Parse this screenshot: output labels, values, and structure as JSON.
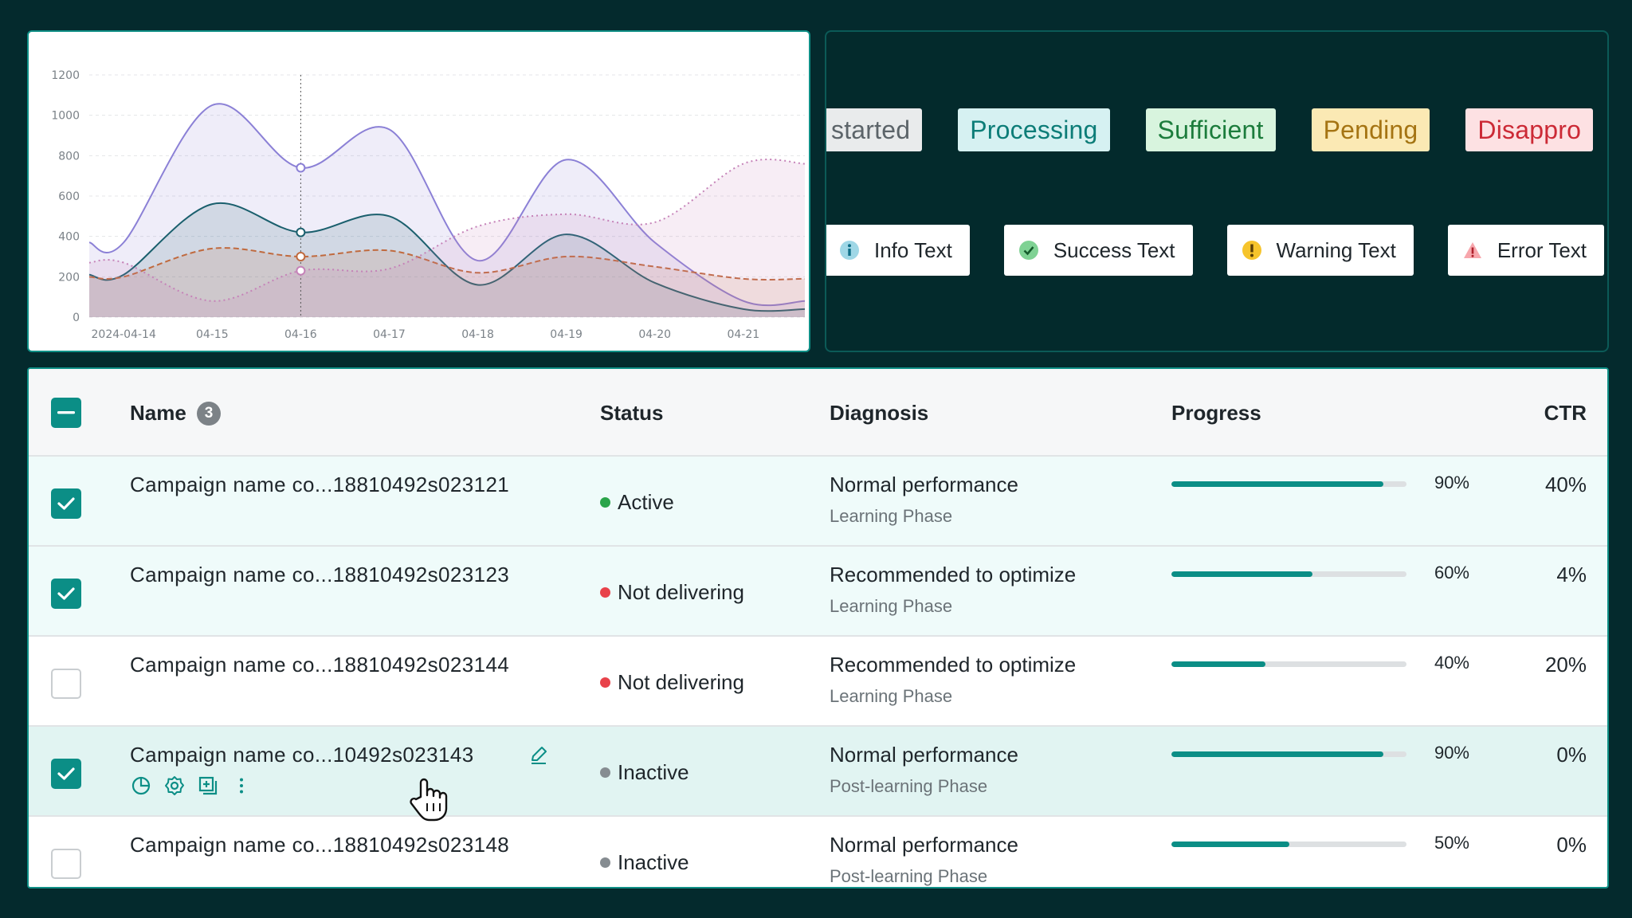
{
  "chart_data": {
    "type": "area",
    "x": [
      "2024-04-14",
      "04-15",
      "04-16",
      "04-17",
      "04-18",
      "04-19",
      "04-20",
      "04-21"
    ],
    "yticks": [
      "0",
      "200",
      "400",
      "600",
      "800",
      "1000",
      "1200"
    ],
    "ylim": [
      0,
      1200
    ],
    "grid": true,
    "hover_x": "04-16",
    "series": [
      {
        "color": "#8b80d6",
        "style": "solid",
        "values": [
          370,
          1050,
          740,
          930,
          280,
          780,
          370,
          80
        ]
      },
      {
        "color": "#1a5f6d",
        "style": "solid",
        "values": [
          210,
          560,
          420,
          500,
          160,
          410,
          170,
          40
        ]
      },
      {
        "color": "#c06a3e",
        "style": "dashed",
        "values": [
          200,
          340,
          300,
          330,
          220,
          300,
          250,
          190
        ]
      },
      {
        "color": "#c582b8",
        "style": "dotted",
        "values": [
          270,
          80,
          230,
          240,
          450,
          510,
          470,
          760
        ]
      }
    ]
  },
  "tags": [
    {
      "label": "started",
      "tone": "grey"
    },
    {
      "label": "Processing",
      "tone": "teal"
    },
    {
      "label": "Sufficient",
      "tone": "green"
    },
    {
      "label": "Pending",
      "tone": "yellow"
    },
    {
      "label": "Disappro",
      "tone": "red"
    }
  ],
  "alerts": [
    {
      "label": "Info Text",
      "icon": "info-icon",
      "color": "#2fa7c4"
    },
    {
      "label": "Success Text",
      "icon": "check-circle-icon",
      "color": "#2a9d4b"
    },
    {
      "label": "Warning Text",
      "icon": "warning-circle-icon",
      "color": "#f2b718"
    },
    {
      "label": "Error Text",
      "icon": "warning-triangle-icon",
      "color": "#e04550"
    }
  ],
  "table": {
    "headers": {
      "name": "Name",
      "name_count": "3",
      "status": "Status",
      "diagnosis": "Diagnosis",
      "progress": "Progress",
      "ctr": "CTR"
    },
    "rows": [
      {
        "name": "Campaign name co...18810492s023121",
        "status": "Active",
        "status_color": "#2aa44a",
        "diagnosis": "Normal performance",
        "phase": "Learning Phase",
        "progress": 90,
        "progress_label": "90%",
        "ctr": "40%",
        "checked": true
      },
      {
        "name": "Campaign name co...18810492s023123",
        "status": "Not delivering",
        "status_color": "#e8424a",
        "diagnosis": "Recommended to optimize",
        "phase": "Learning Phase",
        "progress": 60,
        "progress_label": "60%",
        "ctr": "4%",
        "checked": true
      },
      {
        "name": "Campaign name co...18810492s023144",
        "status": "Not delivering",
        "status_color": "#e8424a",
        "diagnosis": "Recommended to optimize",
        "phase": "Learning Phase",
        "progress": 40,
        "progress_label": "40%",
        "ctr": "20%",
        "checked": false
      },
      {
        "name": "Campaign name co...10492s023143",
        "status": "Inactive",
        "status_color": "#868c91",
        "diagnosis": "Normal performance",
        "phase": "Post-learning Phase",
        "progress": 90,
        "progress_label": "90%",
        "ctr": "0%",
        "checked": true
      },
      {
        "name": "Campaign name co...18810492s023148",
        "status": "Inactive",
        "status_color": "#868c91",
        "diagnosis": "Normal performance",
        "phase": "Post-learning Phase",
        "progress": 50,
        "progress_label": "50%",
        "ctr": "0%",
        "checked": false
      }
    ]
  }
}
